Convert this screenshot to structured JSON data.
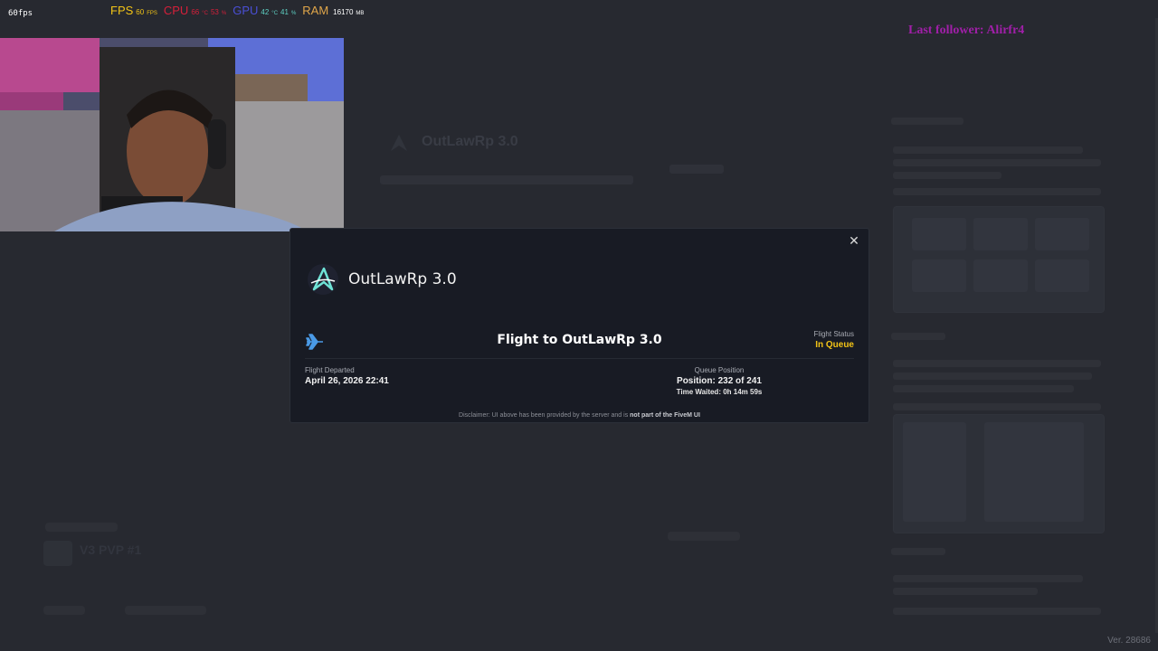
{
  "overlay": {
    "fps_counter": "60fps",
    "hw_stats": {
      "fps_label": "FPS",
      "fps_value": "60",
      "fps_unit": "FPS",
      "cpu_label": "CPU",
      "cpu_temp": "66",
      "cpu_temp_unit": "°C",
      "cpu_load": "53",
      "cpu_load_unit": "%",
      "gpu_label": "GPU",
      "gpu_temp": "42",
      "gpu_temp_unit": "°C",
      "gpu_load": "41",
      "gpu_load_unit": "%",
      "ram_label": "RAM",
      "ram_value": "16170",
      "ram_unit": "MB"
    },
    "last_follower": "Last follower: Alirfr4",
    "colors": {
      "fps": "#f2c316",
      "cpu": "#d61f3a",
      "gpu": "#4a4fd6",
      "ram": "#e0a64a",
      "follower": "#a01fa8"
    }
  },
  "background": {
    "server_title": "OutLawRp 3.0",
    "server_list_item": "V3 PVP #1",
    "version": "Ver. 28686"
  },
  "modal": {
    "close_icon": "close-icon",
    "server_name": "OutLawRp 3.0",
    "flight_title": "Flight to OutLawRp 3.0",
    "flight_status_label": "Flight Status",
    "flight_status_value": "In Queue",
    "departed_label": "Flight Departed",
    "departed_value": "April 26, 2026 22:41",
    "queue_label": "Queue Position",
    "queue_position": "Position: 232 of 241",
    "time_waited": "Time Waited: 0h 14m 59s",
    "disclaimer_text": "Disclaimer: UI above has been provided by the server and is",
    "disclaimer_bold": "not part of the FiveM UI",
    "accent_color": "#f2c316"
  }
}
